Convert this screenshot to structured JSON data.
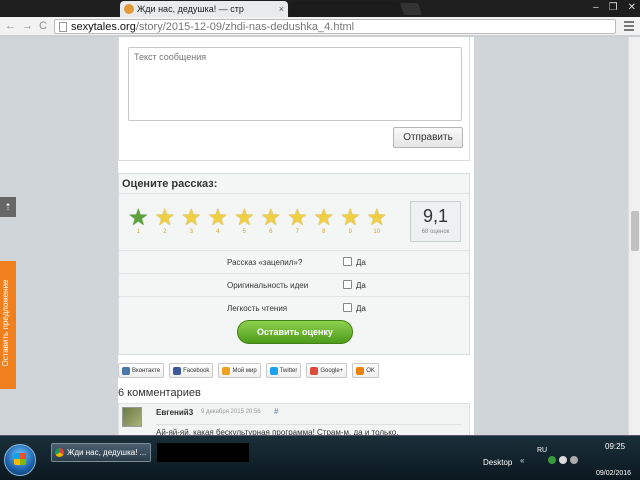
{
  "browser": {
    "tab_title": "Жди нас, дедушка! — стр",
    "tab_close": "×",
    "window_controls": [
      "–",
      "❐",
      "✕"
    ],
    "url_host": "sexytales.org",
    "url_path": "/story/2015-12-09/zhdi-nas-dedushka_4.html",
    "nav": {
      "back": "←",
      "forward": "→",
      "reload": "C"
    }
  },
  "comment_form": {
    "placeholder": "Текст сообщения",
    "send_label": "Отправить"
  },
  "rating": {
    "title": "Оцените рассказ:",
    "selected_star": 1,
    "star_numbers": [
      "1",
      "2",
      "3",
      "4",
      "5",
      "6",
      "7",
      "8",
      "9",
      "10"
    ],
    "score": "9,1",
    "score_count": "68 оценок",
    "criteria": [
      {
        "label": "Рассказ «зацепил»?",
        "yes": "Да"
      },
      {
        "label": "Оригинальность идеи",
        "yes": "Да"
      },
      {
        "label": "Легкость чтения",
        "yes": "Да"
      }
    ],
    "submit_label": "Оставить оценку"
  },
  "share": [
    {
      "label": "Вконтакте",
      "color": "#4a76a8"
    },
    {
      "label": "Facebook",
      "color": "#3b5998"
    },
    {
      "label": "Мой мир",
      "color": "#f0a020"
    },
    {
      "label": "Twitter",
      "color": "#1da1f2"
    },
    {
      "label": "Google+",
      "color": "#dd4b39"
    },
    {
      "label": "OK",
      "color": "#ee8208"
    }
  ],
  "comments": {
    "title": "6 комментариев",
    "first": {
      "author": "Евгений3",
      "date": "9 декабря 2015 20:56",
      "hash": "#",
      "text": "Ай-яй-яй, какая бескультурная программа! Страм-м, да и только."
    }
  },
  "side_tab": {
    "label": "Оставить предложение",
    "up": "⇡"
  },
  "taskbar": {
    "item_title": "Жди нас, дедушка! ...",
    "desktop": "Desktop",
    "lang": "RU",
    "tray_arrow": "«",
    "time": "09:25",
    "date": "09/02/2016"
  }
}
